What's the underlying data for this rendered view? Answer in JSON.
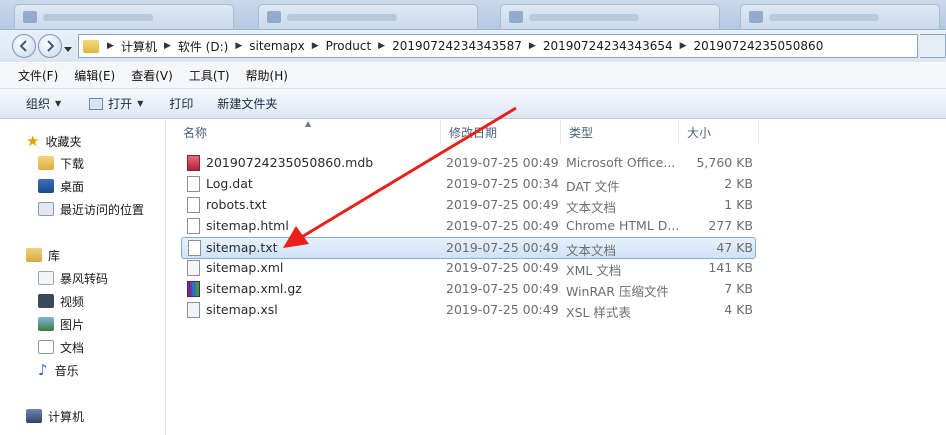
{
  "address": {
    "crumbs": [
      "计算机",
      "软件 (D:)",
      "sitemapx",
      "Product",
      "20190724234343587",
      "20190724234343654",
      "20190724235050860"
    ]
  },
  "menu": {
    "items": [
      "文件(F)",
      "编辑(E)",
      "查看(V)",
      "工具(T)",
      "帮助(H)"
    ]
  },
  "commands": {
    "organize": "组织",
    "open": "打开",
    "print": "打印",
    "new_folder": "新建文件夹"
  },
  "nav": {
    "favorites": "收藏夹",
    "downloads": "下载",
    "desktop": "桌面",
    "recent": "最近访问的位置",
    "libraries": "库",
    "baofeng": "暴风转码",
    "videos": "视频",
    "pictures": "图片",
    "documents": "文档",
    "music": "音乐",
    "computer": "计算机"
  },
  "columns": {
    "name": "名称",
    "modified": "修改日期",
    "type": "类型",
    "size": "大小"
  },
  "files": [
    {
      "name": "20190724235050860.mdb",
      "date": "2019-07-25 00:49",
      "type": "Microsoft Office...",
      "size": "5,760 KB",
      "icon": "access-db-icon"
    },
    {
      "name": "Log.dat",
      "date": "2019-07-25 00:34",
      "type": "DAT 文件",
      "size": "2 KB",
      "icon": "file-icon"
    },
    {
      "name": "robots.txt",
      "date": "2019-07-25 00:49",
      "type": "文本文档",
      "size": "1 KB",
      "icon": "text-file-icon"
    },
    {
      "name": "sitemap.html",
      "date": "2019-07-25 00:49",
      "type": "Chrome HTML D...",
      "size": "277 KB",
      "icon": "html-file-icon"
    },
    {
      "name": "sitemap.txt",
      "date": "2019-07-25 00:49",
      "type": "文本文档",
      "size": "47 KB",
      "icon": "text-file-icon"
    },
    {
      "name": "sitemap.xml",
      "date": "2019-07-25 00:49",
      "type": "XML 文档",
      "size": "141 KB",
      "icon": "xml-file-icon"
    },
    {
      "name": "sitemap.xml.gz",
      "date": "2019-07-25 00:49",
      "type": "WinRAR 压缩文件",
      "size": "7 KB",
      "icon": "winrar-icon"
    },
    {
      "name": "sitemap.xsl",
      "date": "2019-07-25 00:49",
      "type": "XSL 样式表",
      "size": "4 KB",
      "icon": "xsl-file-icon"
    }
  ],
  "colors": {
    "selection_border": "#84acdd",
    "arrow": "#e8221b"
  }
}
